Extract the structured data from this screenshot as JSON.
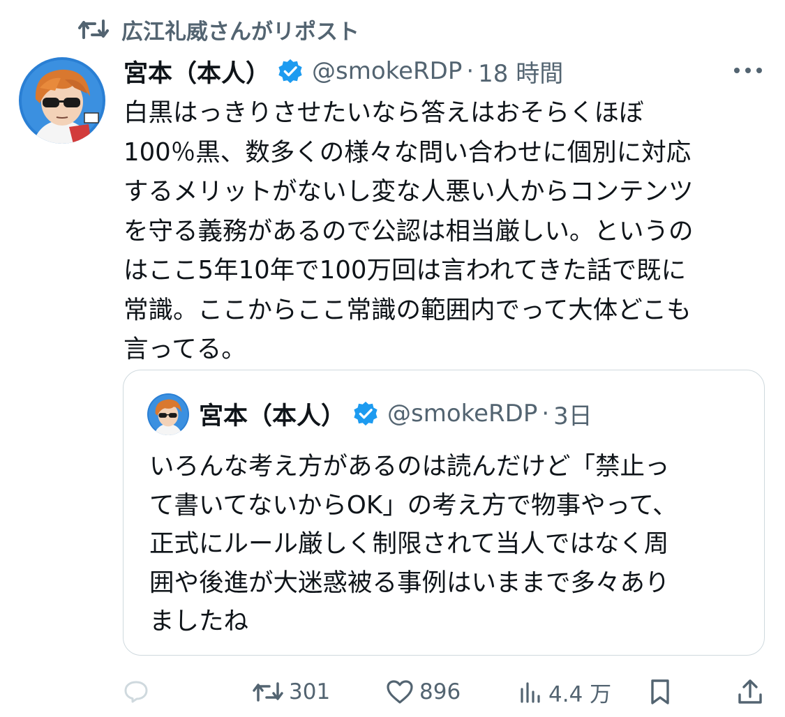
{
  "repost_banner": {
    "icon": "repost-icon",
    "text": "広江礼威さんがリポスト"
  },
  "tweet": {
    "author": {
      "display_name": "宮本（本人）",
      "handle": "@smokeRDP",
      "verified": true,
      "avatar": "anime-character-sunglasses-avatar"
    },
    "separator": "·",
    "time": "18 時間",
    "more_icon": "more-icon",
    "text": "白黒はっきりさせたいなら答えはおそらくほぼ\n100％黒、数多くの様々な問い合わせに個別に対応\nするメリットがないし変な人悪い人からコンテンツ\nを守る義務があるので公認は相当厳しい。というの\nはここ5年10年で100万回は言われてきた話で既に\n常識。ここからここ常識の範囲内でって大体どこも\n言ってる。"
  },
  "quoted_tweet": {
    "author": {
      "display_name": "宮本（本人）",
      "handle": "@smokeRDP",
      "verified": true
    },
    "separator": "·",
    "time": "3日",
    "text": "いろんな考え方があるのは読んだけど「禁止っ\nて書いてないからOK」の考え方で物事やって、\n正式にルール厳しく制限されて当人ではなく周\n囲や後進が大迷惑被る事例はいままで多々あり\nましたね"
  },
  "actions": {
    "reply": {
      "icon": "reply-icon",
      "count": ""
    },
    "repost": {
      "icon": "repost-icon",
      "count": "301"
    },
    "like": {
      "icon": "heart-icon",
      "count": "896"
    },
    "views": {
      "icon": "views-icon",
      "count": "4.4 万"
    },
    "bookmark": {
      "icon": "bookmark-icon"
    },
    "share": {
      "icon": "share-icon"
    }
  },
  "colors": {
    "text_primary": "#0f1419",
    "text_secondary": "#536471",
    "verified_blue": "#1d9bf0",
    "border": "#cfd9de"
  }
}
